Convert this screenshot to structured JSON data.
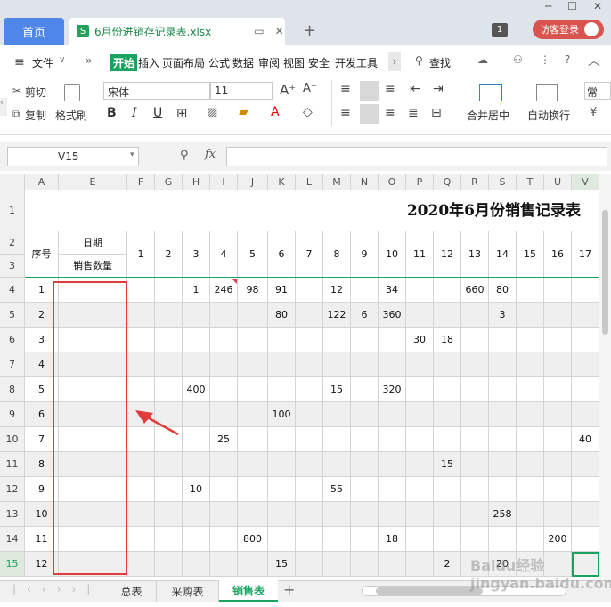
{
  "titlebar": {
    "home_tab": "首页",
    "file_tab": "6月份进销存记录表.xlsx",
    "file_icon": "S",
    "badge": "1",
    "login": "访客登录"
  },
  "menu": {
    "file": "文件",
    "items": [
      "开始",
      "插入",
      "页面布局",
      "公式",
      "数据",
      "审阅",
      "视图",
      "安全",
      "开发工具"
    ],
    "search": "查找"
  },
  "ribbon": {
    "cut": "剪切",
    "copy": "复制",
    "format_painter": "格式刷",
    "font_name": "宋体",
    "font_size": "11",
    "merge_center": "合并居中",
    "wrap_text": "自动换行",
    "number_format": "常"
  },
  "formula_bar": {
    "name_box": "V15",
    "fx": "fx",
    "formula": ""
  },
  "sheet": {
    "columns": [
      "A",
      "E",
      "F",
      "G",
      "H",
      "I",
      "J",
      "K",
      "L",
      "M",
      "N",
      "O",
      "P",
      "Q",
      "R",
      "S",
      "T",
      "U",
      "V"
    ],
    "title": "2020年6月份销售记录表",
    "hdr_seq": "序号",
    "hdr_date": "日期",
    "hdr_qty": "销售数量",
    "days": [
      "1",
      "2",
      "3",
      "4",
      "5",
      "6",
      "7",
      "8",
      "9",
      "10",
      "11",
      "12",
      "13",
      "14",
      "15",
      "16",
      "17"
    ],
    "row_numbers": [
      "1",
      "2",
      "3",
      "4",
      "5",
      "6",
      "7",
      "8",
      "9",
      "10",
      "11",
      "12",
      "13",
      "14",
      "15"
    ],
    "rows": [
      {
        "seq": "1",
        "vals": [
          "",
          "",
          "1",
          "246",
          "98",
          "91",
          "",
          "12",
          "",
          "34",
          "",
          "",
          "660",
          "80",
          "",
          "",
          ""
        ]
      },
      {
        "seq": "2",
        "vals": [
          "",
          "",
          "",
          "",
          "",
          "80",
          "",
          "122",
          "6",
          "360",
          "",
          "",
          "",
          "3",
          "",
          "",
          ""
        ]
      },
      {
        "seq": "3",
        "vals": [
          "",
          "",
          "",
          "",
          "",
          "",
          "",
          "",
          "",
          "",
          "30",
          "18",
          "",
          "",
          "",
          "",
          ""
        ]
      },
      {
        "seq": "4",
        "vals": [
          "",
          "",
          "",
          "",
          "",
          "",
          "",
          "",
          "",
          "",
          "",
          "",
          "",
          "",
          "",
          "",
          ""
        ]
      },
      {
        "seq": "5",
        "vals": [
          "",
          "",
          "400",
          "",
          "",
          "",
          "",
          "15",
          "",
          "320",
          "",
          "",
          "",
          "",
          "",
          "",
          ""
        ]
      },
      {
        "seq": "6",
        "vals": [
          "",
          "",
          "",
          "",
          "",
          "100",
          "",
          "",
          "",
          "",
          "",
          "",
          "",
          "",
          "",
          "",
          ""
        ]
      },
      {
        "seq": "7",
        "vals": [
          "",
          "",
          "",
          "25",
          "",
          "",
          "",
          "",
          "",
          "",
          "",
          "",
          "",
          "",
          "",
          "",
          "40"
        ]
      },
      {
        "seq": "8",
        "vals": [
          "",
          "",
          "",
          "",
          "",
          "",
          "",
          "",
          "",
          "",
          "",
          "15",
          "",
          "",
          "",
          "",
          ""
        ]
      },
      {
        "seq": "9",
        "vals": [
          "",
          "",
          "10",
          "",
          "",
          "",
          "",
          "55",
          "",
          "",
          "",
          "",
          "",
          "",
          "",
          "",
          ""
        ]
      },
      {
        "seq": "10",
        "vals": [
          "",
          "",
          "",
          "",
          "",
          "",
          "",
          "",
          "",
          "",
          "",
          "",
          "",
          "258",
          "",
          "",
          ""
        ]
      },
      {
        "seq": "11",
        "vals": [
          "",
          "",
          "",
          "",
          "800",
          "",
          "",
          "",
          "",
          "18",
          "",
          "",
          "",
          "",
          "",
          "200",
          ""
        ]
      },
      {
        "seq": "12",
        "vals": [
          "",
          "",
          "",
          "",
          "",
          "15",
          "",
          "",
          "",
          "",
          "",
          "2",
          "",
          "20",
          "",
          "",
          ""
        ]
      }
    ]
  },
  "sheet_tabs": [
    "总表",
    "采购表",
    "销售表"
  ],
  "watermark": "Baidu经验 jingyan.baidu.com",
  "colors": {
    "accent": "#1aa260",
    "brand": "#4f87e8",
    "highlight": "#e03c3c"
  }
}
